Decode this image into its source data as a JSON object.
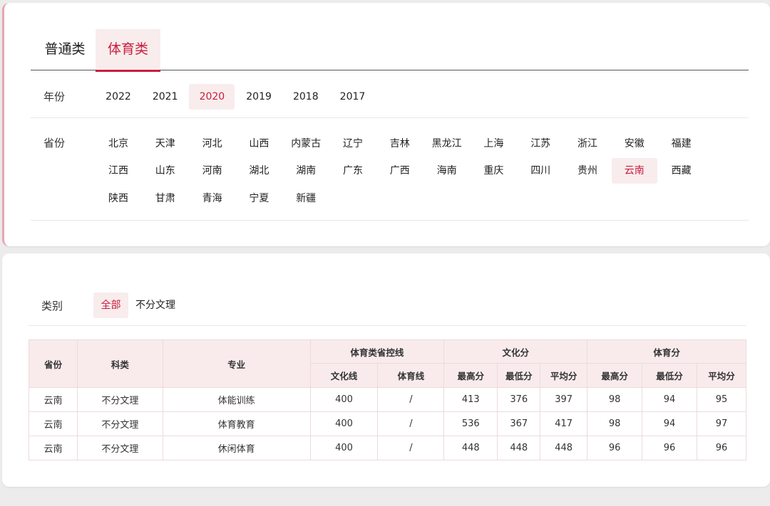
{
  "tabs": [
    {
      "label": "普通类",
      "active": false
    },
    {
      "label": "体育类",
      "active": true
    }
  ],
  "year_filter": {
    "label": "年份",
    "options": [
      "2022",
      "2021",
      "2020",
      "2019",
      "2018",
      "2017"
    ],
    "selected": "2020"
  },
  "province_filter": {
    "label": "省份",
    "rows": [
      [
        "北京",
        "天津",
        "河北",
        "山西",
        "内蒙古",
        "辽宁",
        "吉林",
        "黑龙江",
        "上海",
        "江苏",
        "浙江",
        "安徽",
        "福建"
      ],
      [
        "江西",
        "山东",
        "河南",
        "湖北",
        "湖南",
        "广东",
        "广西",
        "海南",
        "重庆",
        "四川",
        "贵州",
        "云南",
        "西藏"
      ],
      [
        "陕西",
        "甘肃",
        "青海",
        "宁夏",
        "新疆"
      ]
    ],
    "selected": "云南"
  },
  "category_filter": {
    "label": "类别",
    "options": [
      "全部",
      "不分文理"
    ],
    "selected": "全部"
  },
  "table": {
    "headers": {
      "province": "省份",
      "subject": "科类",
      "major": "专业",
      "control_line": "体育类省控线",
      "culture_line": "文化线",
      "sports_line": "体育线",
      "culture_score": "文化分",
      "sports_score": "体育分",
      "max": "最高分",
      "min": "最低分",
      "avg": "平均分"
    },
    "rows": [
      {
        "province": "云南",
        "subject": "不分文理",
        "major": "体能训练",
        "culture_line": "400",
        "sports_line": "/",
        "c_max": "413",
        "c_min": "376",
        "c_avg": "397",
        "s_max": "98",
        "s_min": "94",
        "s_avg": "95"
      },
      {
        "province": "云南",
        "subject": "不分文理",
        "major": "体育教育",
        "culture_line": "400",
        "sports_line": "/",
        "c_max": "536",
        "c_min": "367",
        "c_avg": "417",
        "s_max": "98",
        "s_min": "94",
        "s_avg": "97"
      },
      {
        "province": "云南",
        "subject": "不分文理",
        "major": "休闲体育",
        "culture_line": "400",
        "sports_line": "/",
        "c_max": "448",
        "c_min": "448",
        "c_avg": "448",
        "s_max": "96",
        "s_min": "96",
        "s_avg": "96"
      }
    ]
  },
  "colors": {
    "accent": "#c81e3c",
    "accent_bg": "#f8eced",
    "header_bg": "#f9ebec"
  }
}
